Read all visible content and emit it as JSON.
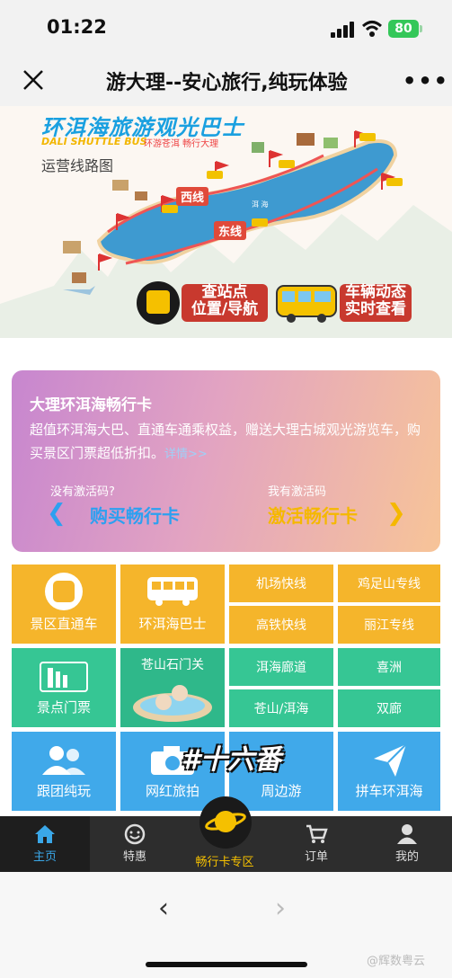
{
  "status": {
    "time": "01:22",
    "battery": "80"
  },
  "titlebar": {
    "title": "游大理--安心旅行,纯玩体验"
  },
  "banner": {
    "title": "环洱海旅游观光巴士",
    "subtitle_en": "DALI SHUTTLE BUS",
    "subtitle_cn": "环游苍洱  畅行大理",
    "route_label": "运营线路图",
    "west_line": "西线",
    "east_line": "东线",
    "lake_name": "洱 海",
    "station_btn": [
      "查站点",
      "位置/导航"
    ],
    "vehicle_btn": [
      "车辆动态",
      "实时查看"
    ]
  },
  "pass": {
    "title": "大理环洱海畅行卡",
    "desc": "超值环洱海大巴、直通车通乘权益，赠送大理古城观光游览车，购买景区门票超低折扣。",
    "detail": "详情>>",
    "no_code": "没有激活码?",
    "have_code": "我有激活码",
    "buy": "购买畅行卡",
    "activate": "激活畅行卡",
    "colors": {
      "buy": "#2da0f0",
      "activate": "#f5b800"
    }
  },
  "grid": {
    "scenic_bus": "景区直通车",
    "erhai_bus": "环洱海巴士",
    "airport": "机场快线",
    "jizu": "鸡足山专线",
    "rail": "高铁快线",
    "lijiang": "丽江专线",
    "tickets": "景点门票",
    "cangshan_gate": "苍山石门关",
    "corridor": "洱海廊道",
    "xizhou": "喜洲",
    "cangshan_erhai": "苍山/洱海",
    "shuanglang": "双廊",
    "group": "跟团纯玩",
    "influencer": "网红旅拍",
    "around": "周边游",
    "carpool": "拼车环洱海",
    "sticker": "#十六番",
    "colors": {
      "yellow": "#f5b52b",
      "green": "#36c694",
      "blue": "#40a9ea"
    }
  },
  "tabs": {
    "home": "主页",
    "deals": "特惠",
    "card": "畅行卡专区",
    "orders": "订单",
    "mine": "我的"
  },
  "watermark": "@辉数粤云"
}
